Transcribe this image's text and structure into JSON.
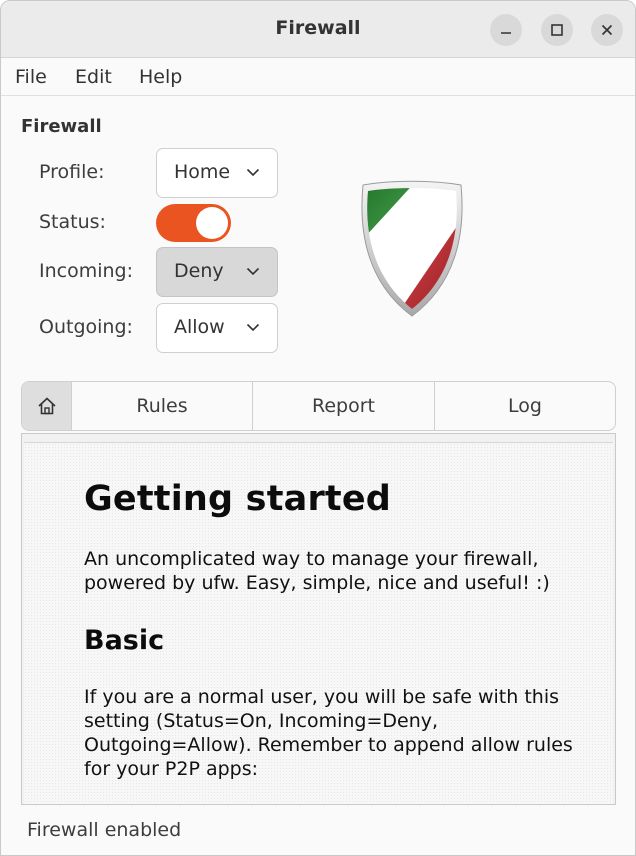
{
  "window": {
    "title": "Firewall",
    "controls": {
      "minimize_icon": "minimize-icon",
      "maximize_icon": "maximize-icon",
      "close_icon": "close-icon"
    }
  },
  "menubar": {
    "items": [
      "File",
      "Edit",
      "Help"
    ]
  },
  "settings": {
    "section_title": "Firewall",
    "profile": {
      "label": "Profile:",
      "value": "Home"
    },
    "status": {
      "label": "Status:",
      "enabled": true
    },
    "incoming": {
      "label": "Incoming:",
      "value": "Deny"
    },
    "outgoing": {
      "label": "Outgoing:",
      "value": "Allow"
    },
    "accent_color": "#e95420"
  },
  "logo": {
    "icon": "gufw-shield-icon",
    "colors": {
      "green": "#2e8b3a",
      "red": "#c0262d",
      "white": "#ffffff"
    }
  },
  "tabs": [
    {
      "icon": "home-icon",
      "label": ""
    },
    {
      "label": "Rules"
    },
    {
      "label": "Report"
    },
    {
      "label": "Log"
    }
  ],
  "content": {
    "heading": "Getting started",
    "intro": "An uncomplicated way to manage your firewall, powered by ufw. Easy, simple, nice and useful! :)",
    "subheading": "Basic",
    "basic_text": "If you are a normal user, you will be safe with this setting (Status=On, Incoming=Deny, Outgoing=Allow). Remember to append allow rules for your P2P apps:"
  },
  "statusbar": {
    "text": "Firewall enabled"
  }
}
